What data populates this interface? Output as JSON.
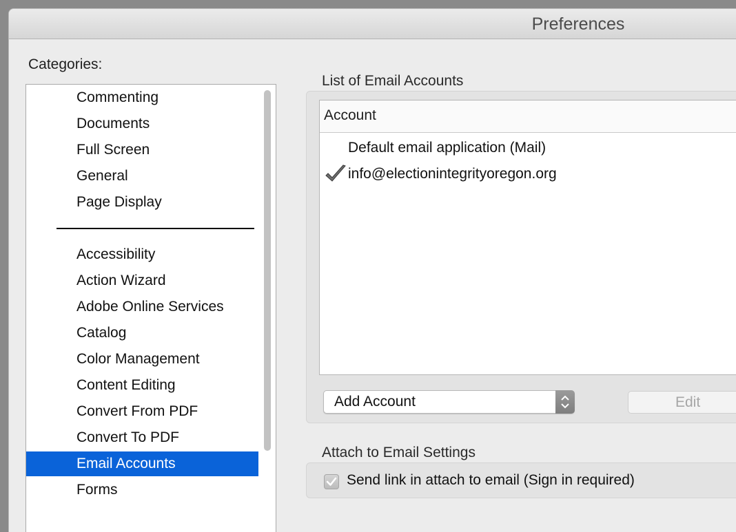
{
  "window": {
    "title": "Preferences"
  },
  "categories": {
    "label": "Categories:",
    "group_1": [
      "Commenting",
      "Documents",
      "Full Screen",
      "General",
      "Page Display"
    ],
    "group_2": [
      "Accessibility",
      "Action Wizard",
      "Adobe Online Services",
      "Catalog",
      "Color Management",
      "Content Editing",
      "Convert From PDF",
      "Convert To PDF",
      "Email Accounts",
      "Forms"
    ],
    "selected": "Email Accounts"
  },
  "email_accounts": {
    "section_title": "List of Email Accounts",
    "column_header": "Account",
    "rows": [
      {
        "label": "Default email application (Mail)",
        "checked": false
      },
      {
        "label": "info@electionintegrityoregon.org",
        "checked": true
      }
    ],
    "add_account_label": "Add Account",
    "edit_label": "Edit"
  },
  "attach_settings": {
    "section_title": "Attach to Email Settings",
    "send_link_label": "Send link in attach to email (Sign in required)",
    "send_link_checked": true
  },
  "colors": {
    "selection": "#0a63d9",
    "window_bg": "#ececec"
  }
}
